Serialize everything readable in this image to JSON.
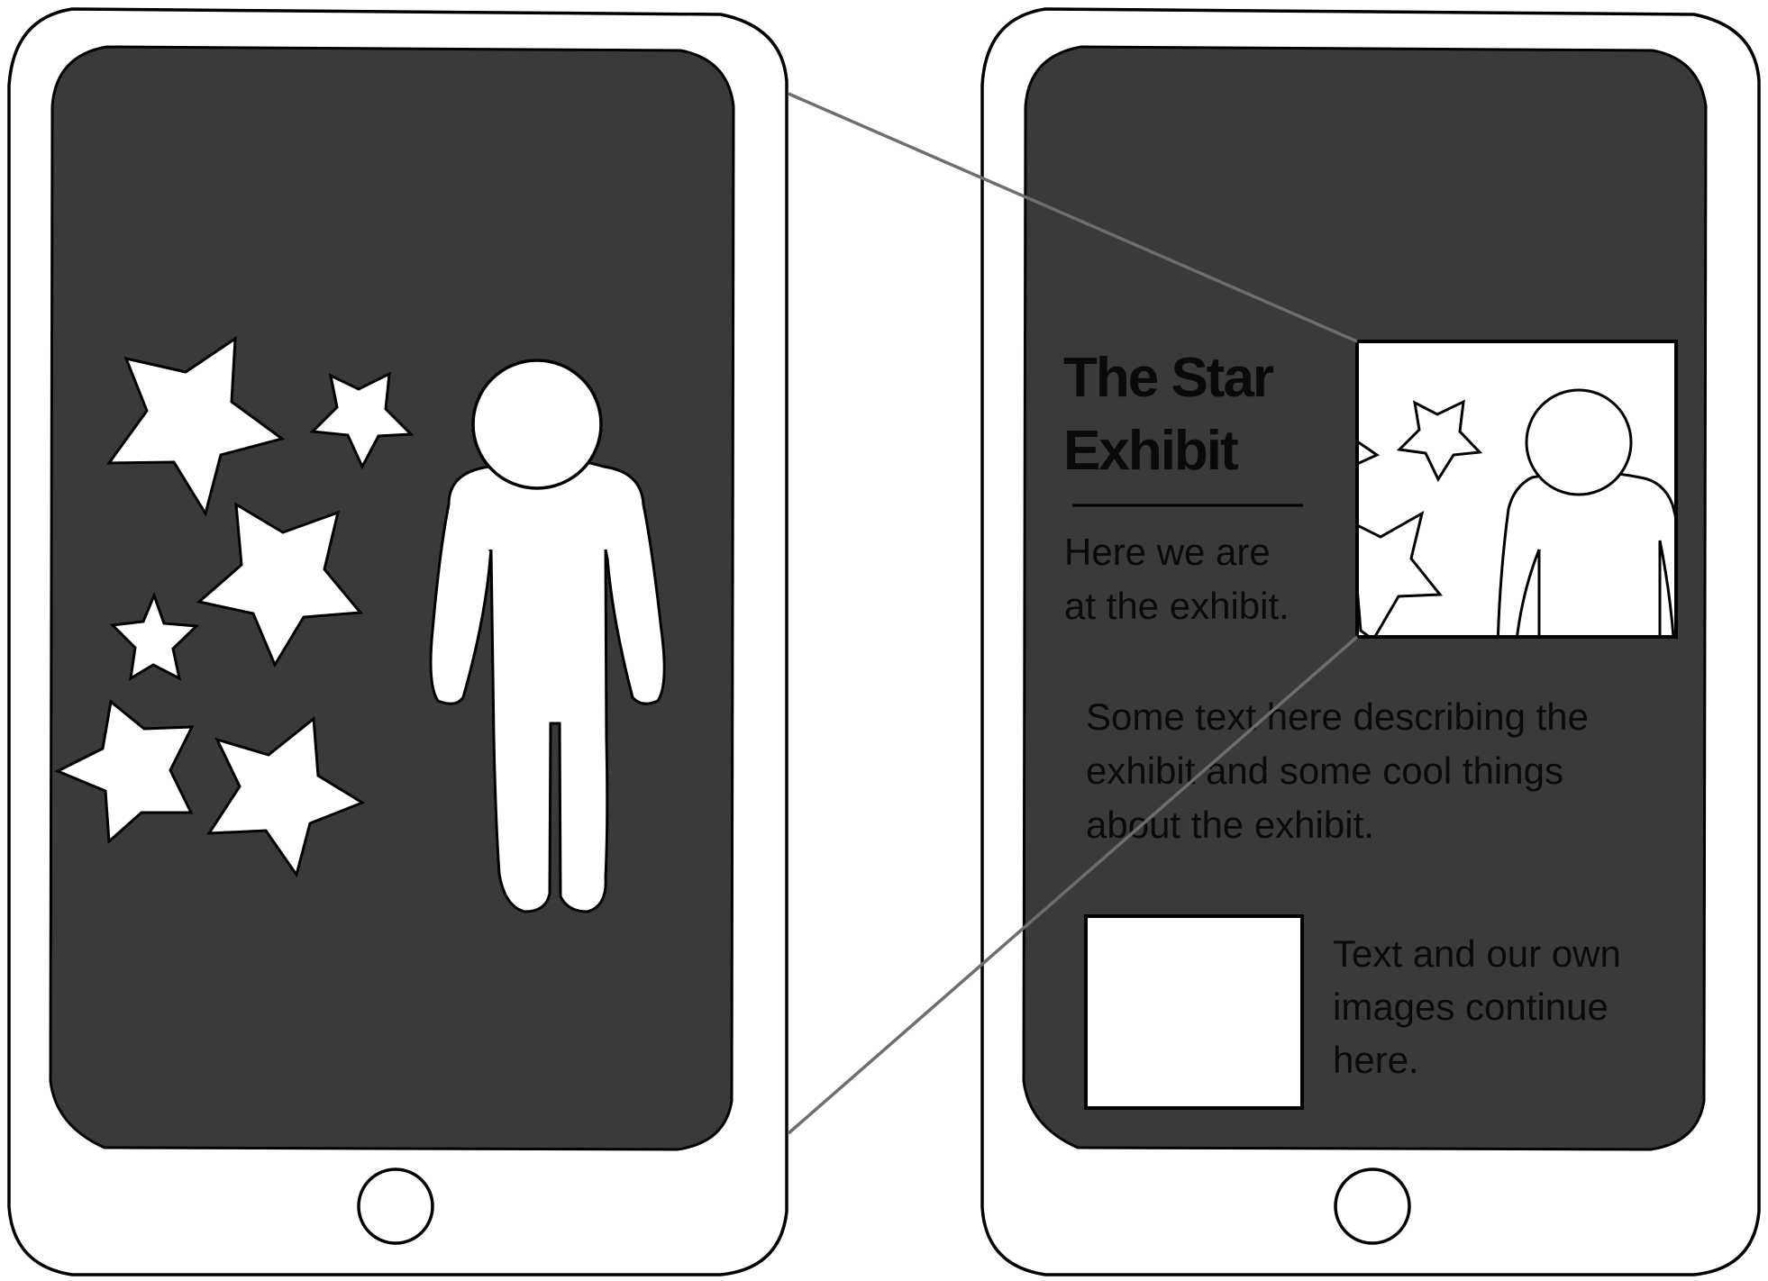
{
  "colors": {
    "screen": "#3a3a3c",
    "outline": "#000000",
    "device_fill": "#ffffff",
    "connector": "#6e6e6e",
    "text": "#0a0a0a"
  },
  "left_device": {
    "screen_content": [
      "star-icon",
      "star-icon",
      "star-icon",
      "star-icon",
      "star-icon",
      "star-icon",
      "person-icon"
    ]
  },
  "right_device": {
    "title_lines": [
      "The Star",
      "Exhibit"
    ],
    "caption_lines": [
      "Here we are",
      "at the exhibit."
    ],
    "description_lines": [
      "Some text here describing the",
      "exhibit and some cool things",
      "about the exhibit."
    ],
    "continue_lines": [
      "Text and our own",
      "images continue",
      "here."
    ]
  }
}
